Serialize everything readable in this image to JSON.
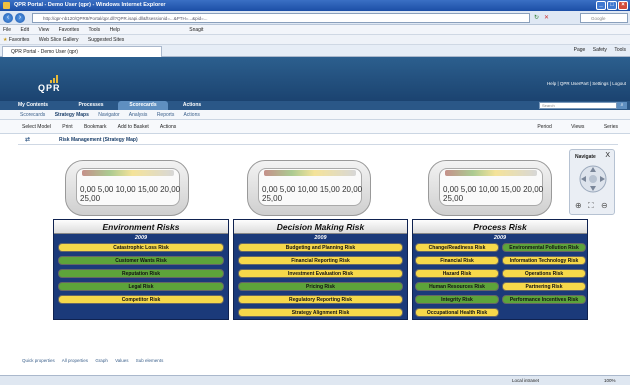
{
  "window": {
    "title": "QPR Portal - Demo User (qpr) - Windows Internet Explorer"
  },
  "browser": {
    "url": "http://qpr-nb120/QPR8/Portal/qpr.dll?QPR.isapi.dll&ftsessionid=...&PTH=...&pid=...",
    "search_placeholder": "Google",
    "menu": [
      "File",
      "Edit",
      "View",
      "Favorites",
      "Tools",
      "Help"
    ],
    "snagit": "Snagit",
    "favorites": "Favorites",
    "fav_items": [
      "Web Slice Gallery",
      "Suggested Sites"
    ],
    "tab_title": "QPR Portal - Demo User (qpr)",
    "commands": [
      "Page",
      "Safety",
      "Tools"
    ]
  },
  "app": {
    "logo": "QPR",
    "top_links": "Help | QPR UserPart | Settings | Logout",
    "nav_tabs": [
      {
        "label": "My Contents",
        "active": false
      },
      {
        "label": "Processes",
        "active": false
      },
      {
        "label": "Scorecards",
        "active": true
      },
      {
        "label": "Actions",
        "active": false
      }
    ],
    "search_placeholder": "Search",
    "subnav": [
      {
        "label": "Scorecards",
        "current": false
      },
      {
        "label": "Strategy Maps",
        "current": true
      },
      {
        "label": "Navigator",
        "current": false
      },
      {
        "label": "Analysis",
        "current": false
      },
      {
        "label": "Reports",
        "current": false
      },
      {
        "label": "Actions",
        "current": false
      }
    ],
    "toolbar": [
      "Select Model",
      "Print",
      "Bookmark",
      "Add to Basket",
      "Actions"
    ],
    "toolbar_right": [
      "Period",
      "Views",
      "Series"
    ],
    "breadcrumb": "Risk Management (Strategy Map)",
    "crumb_icon": "⇄"
  },
  "gauges": [
    {
      "labels": "0,00  5,00  10,00 15,00 20,00 25,00"
    },
    {
      "labels": "0,00  5,00  10,00 15,00 20,00 25,00"
    },
    {
      "labels": "0,00  5,00  10,00 15,00 20,00 25,00"
    }
  ],
  "panels": [
    {
      "title": "Environment Risks",
      "year": "2009",
      "risks": [
        {
          "label": "Catastrophic Loss Risk",
          "color": "yellow"
        },
        {
          "label": "Customer Wants Risk",
          "color": "green"
        },
        {
          "label": "Reputation Risk",
          "color": "green"
        },
        {
          "label": "Legal Risk",
          "color": "green"
        },
        {
          "label": "Competitor Risk",
          "color": "yellow"
        }
      ]
    },
    {
      "title": "Decision Making Risk",
      "year": "2009",
      "risks": [
        {
          "label": "Budgeting and Planning Risk",
          "color": "yellow"
        },
        {
          "label": "Financial Reporting Risk",
          "color": "yellow"
        },
        {
          "label": "Investment Evaluation Risk",
          "color": "yellow"
        },
        {
          "label": "Pricing Risk",
          "color": "green"
        },
        {
          "label": "Regulatory Reporting Risk",
          "color": "yellow"
        },
        {
          "label": "Strategy Alignment Risk",
          "color": "yellow"
        }
      ]
    },
    {
      "title": "Process Risk",
      "year": "2009",
      "risks": [
        {
          "label": "Change/Readiness Risk",
          "color": "yellow"
        },
        {
          "label": "Environmental Pollution Risk",
          "color": "green"
        },
        {
          "label": "Financial Risk",
          "color": "yellow"
        },
        {
          "label": "Information Technology Risk",
          "color": "yellow"
        },
        {
          "label": "Hazard Risk",
          "color": "yellow"
        },
        {
          "label": "Operations Risk",
          "color": "yellow"
        },
        {
          "label": "Human Resources Risk",
          "color": "green"
        },
        {
          "label": "Partnering Risk",
          "color": "yellow"
        },
        {
          "label": "Integrity Risk",
          "color": "green"
        },
        {
          "label": "Performance Incentives Risk",
          "color": "green"
        },
        {
          "label": "Occupational Health Risk",
          "color": "yellow"
        }
      ]
    }
  ],
  "navigate": {
    "title": "Navigate",
    "close": "X"
  },
  "bottom_tabs": [
    "Quick properties",
    "All properties",
    "Graph",
    "Values",
    "Sub elements"
  ],
  "status": {
    "zone": "Local intranet",
    "zoom": "100%"
  },
  "colors": {
    "panel_bg": "#1b3a7a",
    "risk_yellow": "#f6d84a",
    "risk_green": "#5da43a",
    "header": "#2c5f8e"
  }
}
